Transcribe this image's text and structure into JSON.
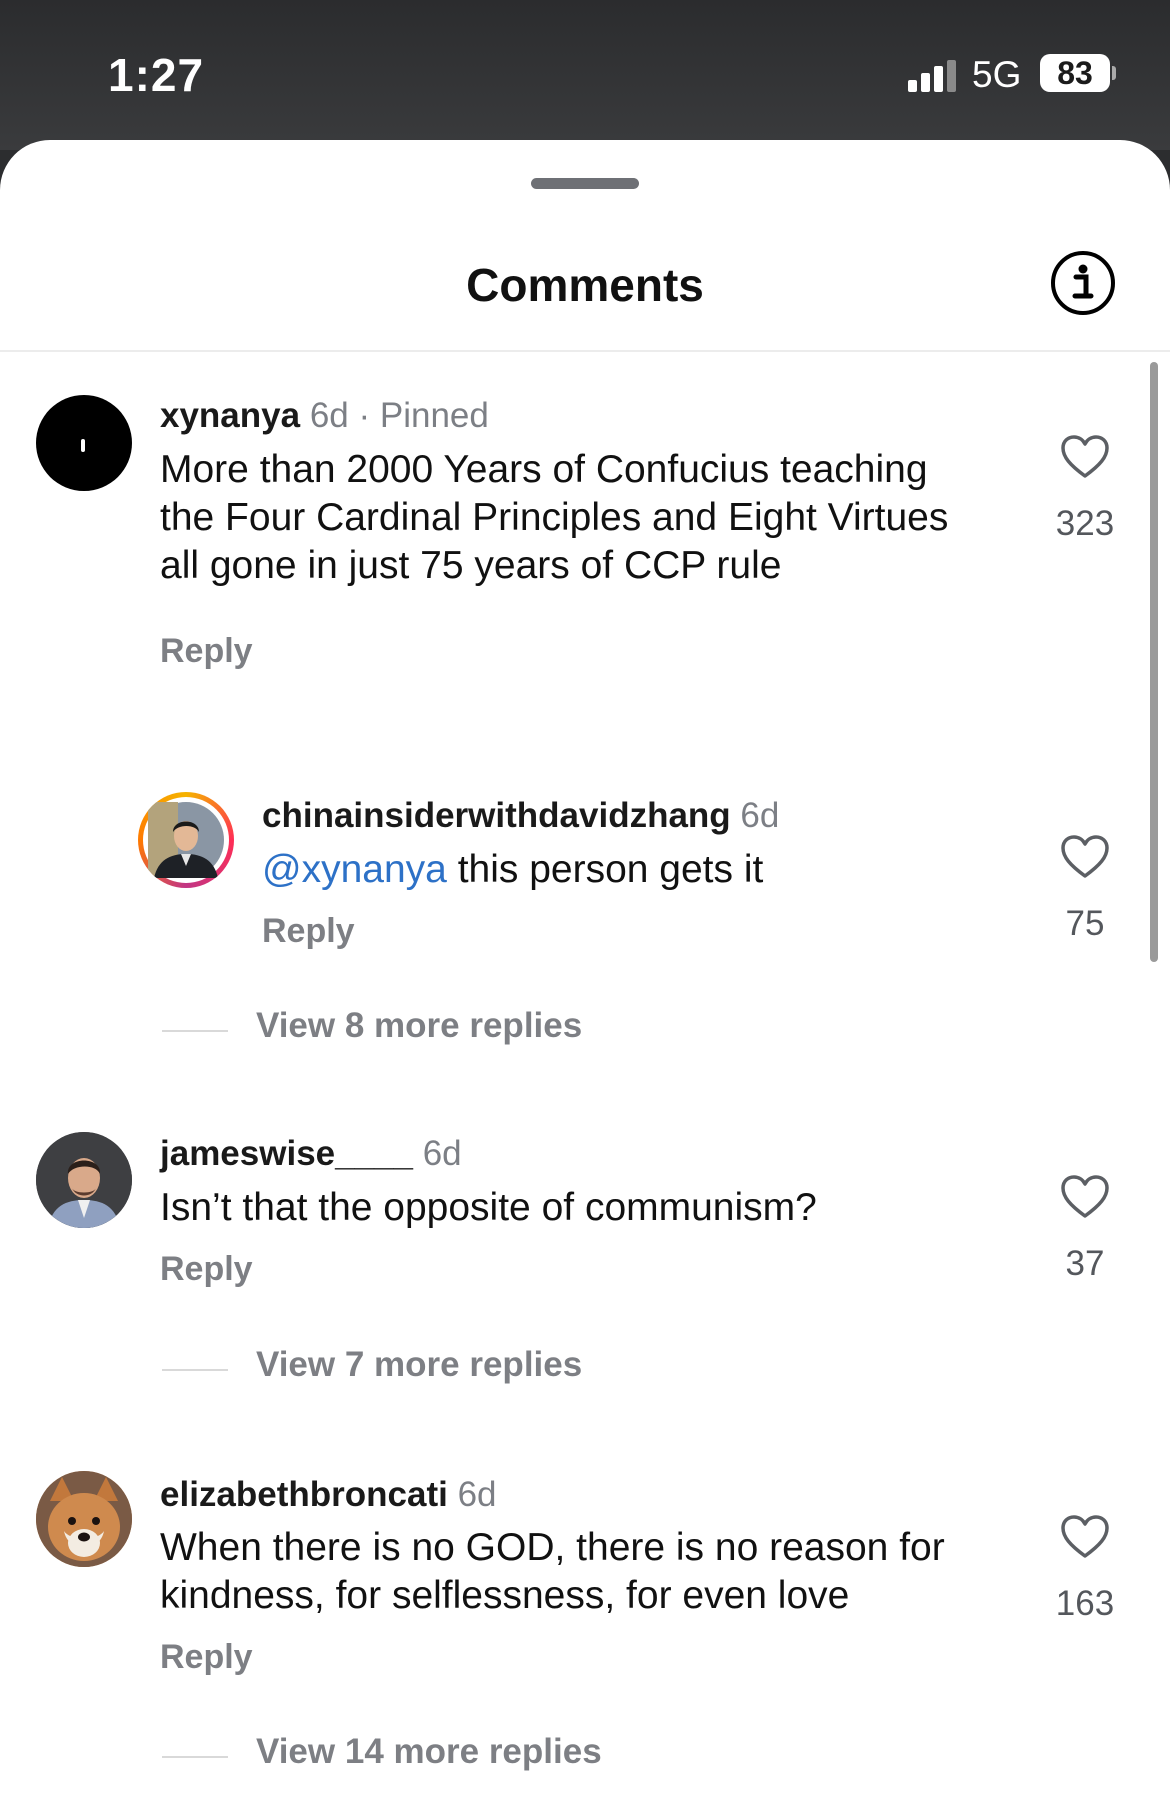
{
  "status": {
    "time": "1:27",
    "network": "5G",
    "battery": "83"
  },
  "header": {
    "title": "Comments"
  },
  "comments": [
    {
      "username": "xynanya",
      "age": "6d",
      "pinned": "· Pinned",
      "text": "More than 2000 Years of Confucius teaching the Four Cardinal Principles and Eight Virtues all gone in just 75 years of CCP rule",
      "reply": "Reply",
      "likes": "323"
    },
    {
      "username": "jameswise____",
      "age": "6d",
      "text": "Isn’t that the opposite of communism?",
      "reply": "Reply",
      "likes": "37",
      "view_more": "View 7 more replies"
    },
    {
      "username": "elizabethbroncati",
      "age": "6d",
      "text": "When there is no GOD, there is no reason for kindness, for selflessness, for even love",
      "reply": "Reply",
      "likes": "163",
      "view_more": "View 14 more replies"
    }
  ],
  "nested_reply": {
    "username": "chinainsiderwithdavidzhang",
    "age": "6d",
    "mention": "@xynanya",
    "text": " this person gets it",
    "reply": "Reply",
    "likes": "75",
    "view_more": "View 8 more replies"
  },
  "icons": {
    "info": "info-icon",
    "like": "heart-icon",
    "signal": "signal-icon"
  },
  "colors": {
    "mention": "#2d71c7",
    "sheet": "#ffffff",
    "statusbar": "#2c2d2f"
  }
}
